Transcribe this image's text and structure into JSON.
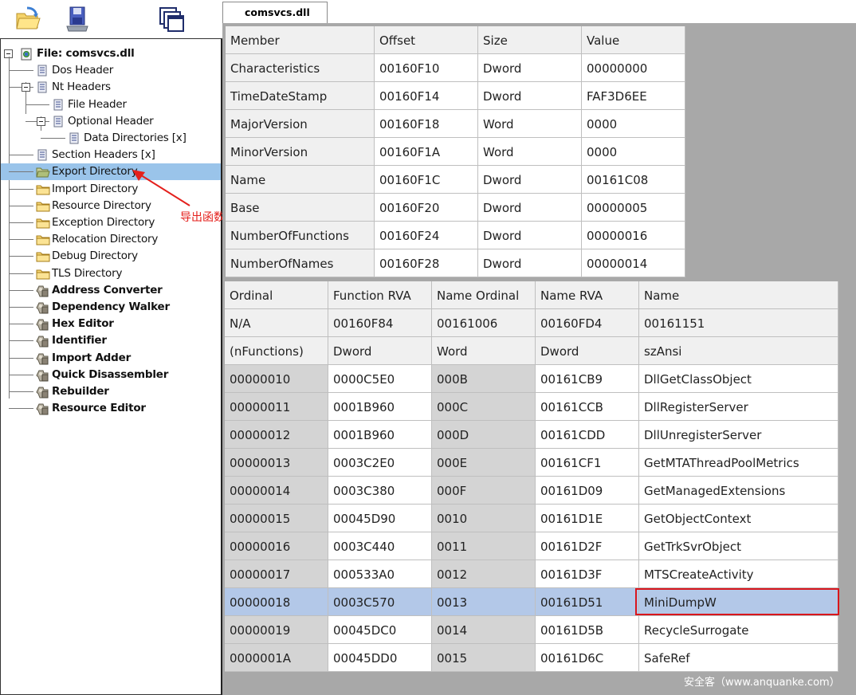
{
  "toolbar": {
    "icons": [
      "open-file-icon",
      "save-icon",
      "windows-icon"
    ]
  },
  "tree": {
    "root_label": "File: comsvcs.dll",
    "items": [
      {
        "label": "Dos Header"
      },
      {
        "label": "Nt Headers"
      },
      {
        "label": "File Header"
      },
      {
        "label": "Optional Header"
      },
      {
        "label": "Data Directories [x]"
      },
      {
        "label": "Section Headers [x]"
      },
      {
        "label": "Export Directory"
      },
      {
        "label": "Import Directory"
      },
      {
        "label": "Resource Directory"
      },
      {
        "label": "Exception Directory"
      },
      {
        "label": "Relocation Directory"
      },
      {
        "label": "Debug Directory"
      },
      {
        "label": "TLS Directory"
      },
      {
        "label": "Address Converter"
      },
      {
        "label": "Dependency Walker"
      },
      {
        "label": "Hex Editor"
      },
      {
        "label": "Identifier"
      },
      {
        "label": "Import Adder"
      },
      {
        "label": "Quick Disassembler"
      },
      {
        "label": "Rebuilder"
      },
      {
        "label": "Resource Editor"
      }
    ]
  },
  "annotation": {
    "text": "导出函数",
    "color": "#e4201c"
  },
  "tab": {
    "label": "comsvcs.dll"
  },
  "export_table": {
    "headers": [
      "Member",
      "Offset",
      "Size",
      "Value"
    ],
    "rows": [
      [
        "Characteristics",
        "00160F10",
        "Dword",
        "00000000"
      ],
      [
        "TimeDateStamp",
        "00160F14",
        "Dword",
        "FAF3D6EE"
      ],
      [
        "MajorVersion",
        "00160F18",
        "Word",
        "0000"
      ],
      [
        "MinorVersion",
        "00160F1A",
        "Word",
        "0000"
      ],
      [
        "Name",
        "00160F1C",
        "Dword",
        "00161C08"
      ],
      [
        "Base",
        "00160F20",
        "Dword",
        "00000005"
      ],
      [
        "NumberOfFunctions",
        "00160F24",
        "Dword",
        "00000016"
      ],
      [
        "NumberOfNames",
        "00160F28",
        "Dword",
        "00000014"
      ]
    ]
  },
  "functions_table": {
    "headers": [
      "Ordinal",
      "Function RVA",
      "Name Ordinal",
      "Name RVA",
      "Name"
    ],
    "sub1": [
      "N/A",
      "00160F84",
      "00161006",
      "00160FD4",
      "00161151"
    ],
    "sub2": [
      "(nFunctions)",
      "Dword",
      "Word",
      "Dword",
      "szAnsi"
    ],
    "rows": [
      [
        "00000010",
        "0000C5E0",
        "000B",
        "00161CB9",
        "DllGetClassObject"
      ],
      [
        "00000011",
        "0001B960",
        "000C",
        "00161CCB",
        "DllRegisterServer"
      ],
      [
        "00000012",
        "0001B960",
        "000D",
        "00161CDD",
        "DllUnregisterServer"
      ],
      [
        "00000013",
        "0003C2E0",
        "000E",
        "00161CF1",
        "GetMTAThreadPoolMetrics"
      ],
      [
        "00000014",
        "0003C380",
        "000F",
        "00161D09",
        "GetManagedExtensions"
      ],
      [
        "00000015",
        "00045D90",
        "0010",
        "00161D1E",
        "GetObjectContext"
      ],
      [
        "00000016",
        "0003C440",
        "0011",
        "00161D2F",
        "GetTrkSvrObject"
      ],
      [
        "00000017",
        "000533A0",
        "0012",
        "00161D3F",
        "MTSCreateActivity"
      ],
      [
        "00000018",
        "0003C570",
        "0013",
        "00161D51",
        "MiniDumpW"
      ],
      [
        "00000019",
        "00045DC0",
        "0014",
        "00161D5B",
        "RecycleSurrogate"
      ],
      [
        "0000001A",
        "00045DD0",
        "0015",
        "00161D6C",
        "SafeRef"
      ]
    ],
    "selected_row": 8,
    "highlight_color": "#d9161c"
  },
  "watermark": "安全客（www.anquanke.com）"
}
